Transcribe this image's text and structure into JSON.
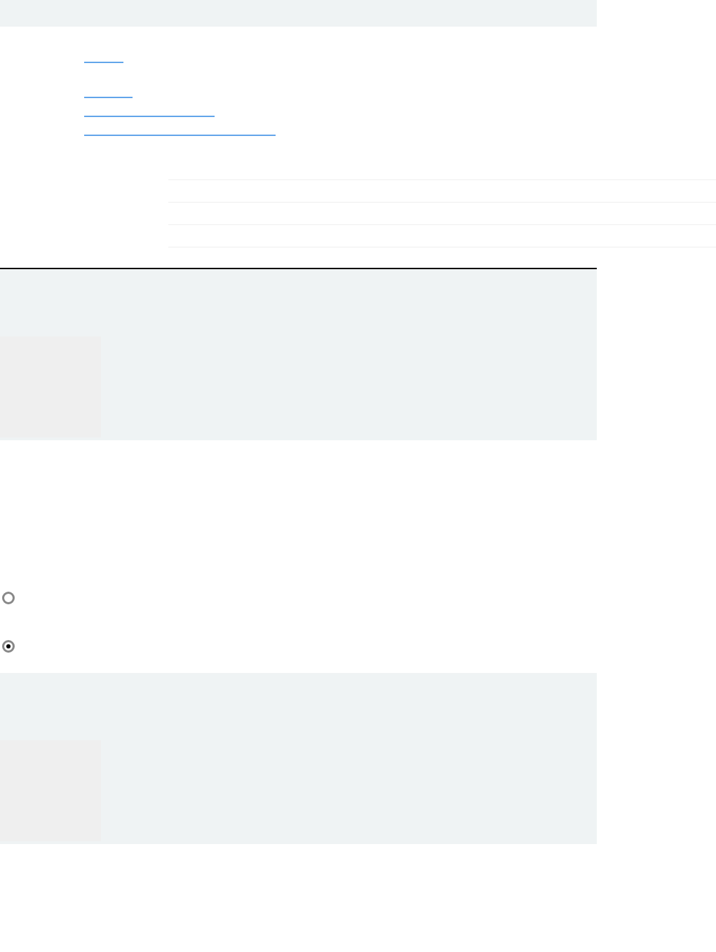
{
  "radio_options": [
    {
      "selected": false
    },
    {
      "selected": true
    }
  ]
}
